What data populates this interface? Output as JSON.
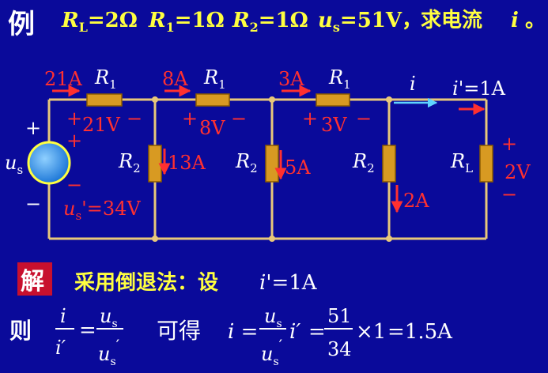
{
  "colors": {
    "background": "#0a0a9a",
    "wire": "#e8c87a",
    "resistor_fill": "#d89a22",
    "red": "#ff3030",
    "yellow": "#ffff40",
    "white": "#ffffff",
    "cyan_arrow": "#5fd3ff",
    "source_blue": "#1e78d8",
    "solution_badge": "#c8102e"
  },
  "header": {
    "example_char": "例",
    "rl": {
      "sym": "R",
      "sub": "L",
      "val": "=2Ω"
    },
    "r1": {
      "sym": "R",
      "sub": "1",
      "val": "=1Ω"
    },
    "r2": {
      "sym": "R",
      "sub": "2",
      "val": "=1Ω"
    },
    "us": {
      "sym": "u",
      "sub": "s",
      "val": "=51V，"
    },
    "ask": "求电流",
    "i_sym": "i",
    "end": "。"
  },
  "circuit": {
    "r1_sym": "R",
    "r1_sub": "1",
    "r2_sym": "R",
    "r2_sub": "2",
    "rl_sym": "R",
    "rl_sub": "L",
    "us_sym": "u",
    "us_sub": "s",
    "plus": "+",
    "minus": "−",
    "currents_top": [
      "21A",
      "8A",
      "3A"
    ],
    "i_label": "i",
    "i_prime_label": "i'=1A",
    "r1_voltages": [
      "21V",
      "8V",
      "3V"
    ],
    "shunt_currents": [
      "13A",
      "5A",
      "2A"
    ],
    "rl_voltage": "2V",
    "us_prime": {
      "sym": "u",
      "sub": "s",
      "val": "'=34V"
    }
  },
  "solution": {
    "badge": "解",
    "method": "采用倒退法：设",
    "assume": "i'=1A",
    "then": "则",
    "frac_i_top": "i",
    "frac_i_bot": "i′",
    "eq": "=",
    "frac_u_top": "u",
    "frac_u_top_sub": "s",
    "frac_u_bot": "u",
    "frac_u_bot_sub": "s",
    "prime": "′",
    "get": "可得",
    "i_eq": "i =",
    "i_prime_mult": "i′",
    "eq2": "=",
    "num": "51",
    "den": "34",
    "times": "×1",
    "result": "=1.5A"
  }
}
